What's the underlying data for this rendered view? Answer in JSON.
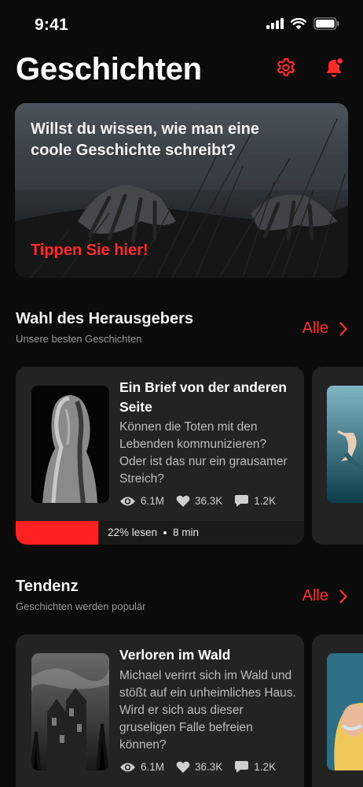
{
  "status": {
    "time": "9:41"
  },
  "header": {
    "title": "Geschichten"
  },
  "banner": {
    "text": "Willst du wissen, wie man eine coole Geschichte schreibt?",
    "cta": "Tippen Sie hier!"
  },
  "sections": [
    {
      "title": "Wahl des Herausgebers",
      "subtitle": "Unsere besten Geschichten",
      "see_all": "Alle",
      "card": {
        "title": "Ein Brief von der anderen Seite",
        "description": "Können die Toten mit den Lebenden kommunizieren? Oder ist das nur ein grausamer Streich?",
        "views": "6.1M",
        "likes": "36.3K",
        "comments": "1.2K",
        "progress_label": "22% lesen",
        "progress_value": 0.22,
        "duration": "8 min"
      }
    },
    {
      "title": "Tendenz",
      "subtitle": "Geschichten werden populär",
      "see_all": "Alle",
      "card": {
        "title": "Verloren im Wald",
        "description": "Michael verirrt sich im Wald und stößt auf ein unheimliches Haus. Wird er sich aus dieser gruseligen Falle befreien können?",
        "views": "6.1M",
        "likes": "36.3K",
        "comments": "1.2K"
      }
    }
  ],
  "colors": {
    "accent": "#ff2a2a",
    "background": "#0c0b0b",
    "card": "#242323"
  },
  "icons": [
    "signal-icon",
    "wifi-icon",
    "battery-icon",
    "settings-gear-icon",
    "notification-bell-icon",
    "chevron-right-icon",
    "eye-icon",
    "heart-icon",
    "comment-icon"
  ]
}
